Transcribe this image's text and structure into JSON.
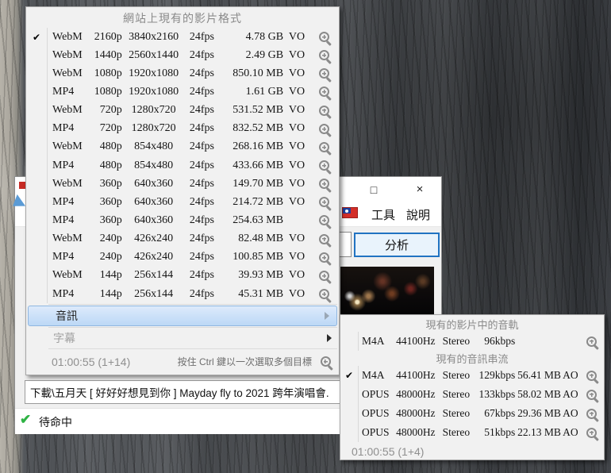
{
  "icons": {
    "check": "✔"
  },
  "video_menu": {
    "title": "網站上現有的影片格式",
    "items": [
      {
        "checked": true,
        "container": "WebM",
        "quality": "2160p",
        "dims": "3840x2160",
        "fps": "24fps",
        "size": "4.78 GB",
        "flag": "VO"
      },
      {
        "checked": false,
        "container": "WebM",
        "quality": "1440p",
        "dims": "2560x1440",
        "fps": "24fps",
        "size": "2.49 GB",
        "flag": "VO"
      },
      {
        "checked": false,
        "container": "WebM",
        "quality": "1080p",
        "dims": "1920x1080",
        "fps": "24fps",
        "size": "850.10 MB",
        "flag": "VO"
      },
      {
        "checked": false,
        "container": "MP4",
        "quality": "1080p",
        "dims": "1920x1080",
        "fps": "24fps",
        "size": "1.61 GB",
        "flag": "VO"
      },
      {
        "checked": false,
        "container": "WebM",
        "quality": "720p",
        "dims": "1280x720",
        "fps": "24fps",
        "size": "531.52 MB",
        "flag": "VO"
      },
      {
        "checked": false,
        "container": "MP4",
        "quality": "720p",
        "dims": "1280x720",
        "fps": "24fps",
        "size": "832.52 MB",
        "flag": "VO"
      },
      {
        "checked": false,
        "container": "WebM",
        "quality": "480p",
        "dims": "854x480",
        "fps": "24fps",
        "size": "268.16 MB",
        "flag": "VO"
      },
      {
        "checked": false,
        "container": "MP4",
        "quality": "480p",
        "dims": "854x480",
        "fps": "24fps",
        "size": "433.66 MB",
        "flag": "VO"
      },
      {
        "checked": false,
        "container": "WebM",
        "quality": "360p",
        "dims": "640x360",
        "fps": "24fps",
        "size": "149.70 MB",
        "flag": "VO"
      },
      {
        "checked": false,
        "container": "MP4",
        "quality": "360p",
        "dims": "640x360",
        "fps": "24fps",
        "size": "214.72 MB",
        "flag": "VO"
      },
      {
        "checked": false,
        "container": "MP4",
        "quality": "360p",
        "dims": "640x360",
        "fps": "24fps",
        "size": "254.63 MB",
        "flag": ""
      },
      {
        "checked": false,
        "container": "WebM",
        "quality": "240p",
        "dims": "426x240",
        "fps": "24fps",
        "size": "82.48 MB",
        "flag": "VO"
      },
      {
        "checked": false,
        "container": "MP4",
        "quality": "240p",
        "dims": "426x240",
        "fps": "24fps",
        "size": "100.85 MB",
        "flag": "VO"
      },
      {
        "checked": false,
        "container": "WebM",
        "quality": "144p",
        "dims": "256x144",
        "fps": "24fps",
        "size": "39.93 MB",
        "flag": "VO"
      },
      {
        "checked": false,
        "container": "MP4",
        "quality": "144p",
        "dims": "256x144",
        "fps": "24fps",
        "size": "45.31 MB",
        "flag": "VO"
      }
    ],
    "audio_item": {
      "label": "音訊"
    },
    "subtitle_item": {
      "label": "字幕"
    },
    "footer": {
      "duration": "01:00:55 (1+14)",
      "hint": "按住 Ctrl 鍵以一次選取多個目標"
    }
  },
  "audio_menu": {
    "track_header": "現有的影片中的音軌",
    "track_items": [
      {
        "checked": false,
        "codec": "M4A",
        "sample_rate": "44100Hz",
        "channels": "Stereo",
        "bitrate": "96kbps",
        "size": "",
        "flag": ""
      }
    ],
    "stream_header": "現有的音訊串流",
    "stream_items": [
      {
        "checked": true,
        "codec": "M4A",
        "sample_rate": "44100Hz",
        "channels": "Stereo",
        "bitrate": "129kbps",
        "size": "56.41 MB",
        "flag": "AO"
      },
      {
        "checked": false,
        "codec": "OPUS",
        "sample_rate": "48000Hz",
        "channels": "Stereo",
        "bitrate": "133kbps",
        "size": "58.02 MB",
        "flag": "AO"
      },
      {
        "checked": false,
        "codec": "OPUS",
        "sample_rate": "48000Hz",
        "channels": "Stereo",
        "bitrate": "67kbps",
        "size": "29.36 MB",
        "flag": "AO"
      },
      {
        "checked": false,
        "codec": "OPUS",
        "sample_rate": "48000Hz",
        "channels": "Stereo",
        "bitrate": "51kbps",
        "size": "22.13 MB",
        "flag": "AO"
      }
    ],
    "footer": {
      "duration": "01:00:55 (1+4)"
    }
  },
  "app_window": {
    "maximize_label": "□",
    "close_label": "×",
    "menu": {
      "tools": "工具",
      "help": "說明"
    },
    "analyze_button": "分析"
  },
  "output_path_field": {
    "value": "下載\\五月天 [ 好好好想見到你 ] Mayday fly to 2021 跨年演唱會."
  },
  "status_bar": {
    "text": "待命中"
  }
}
